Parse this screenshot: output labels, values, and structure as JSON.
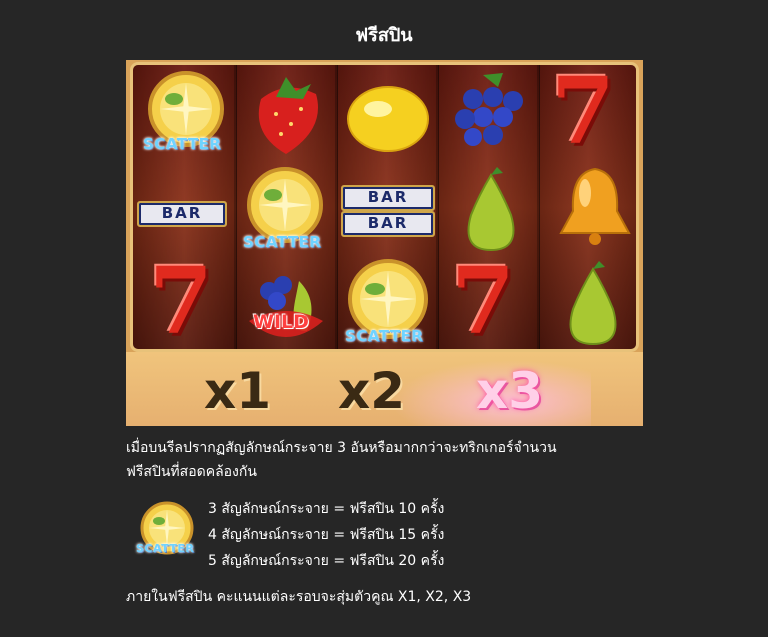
{
  "title": "ฟรีสปิน",
  "reels": {
    "scatter_label": "SCATTER",
    "bar_label": "BAR",
    "wild_label": "WILD",
    "seven_label": "7",
    "grid": [
      [
        "scatter",
        "strawberry",
        "lemon",
        "grapes",
        "seven"
      ],
      [
        "bar",
        "scatter",
        "double-bar",
        "pear",
        "bell"
      ],
      [
        "seven",
        "wild",
        "scatter",
        "seven",
        "pear"
      ]
    ]
  },
  "multipliers": [
    "x1",
    "x2",
    "x3"
  ],
  "description": {
    "line1": "เมื่อบนรีลปรากฏสัญลักษณ์กระจาย 3 อันหรือมากกว่าจะทริกเกอร์จำนวน",
    "line2": "ฟรีสปินที่สอดคล้องกัน"
  },
  "paytable": {
    "icon_label": "SCATTER",
    "rows": [
      "3 สัญลักษณ์กระจาย = ฟรีสปิน 10 ครั้ง",
      "4 สัญลักษณ์กระจาย = ฟรีสปิน 15 ครั้ง",
      "5 สัญลักษณ์กระจาย = ฟรีสปิน 20 ครั้ง"
    ]
  },
  "footer": "ภายในฟรีสปิน คะแนนแต่ละรอบจะสุ่มตัวคูณ X1, X2, X3"
}
